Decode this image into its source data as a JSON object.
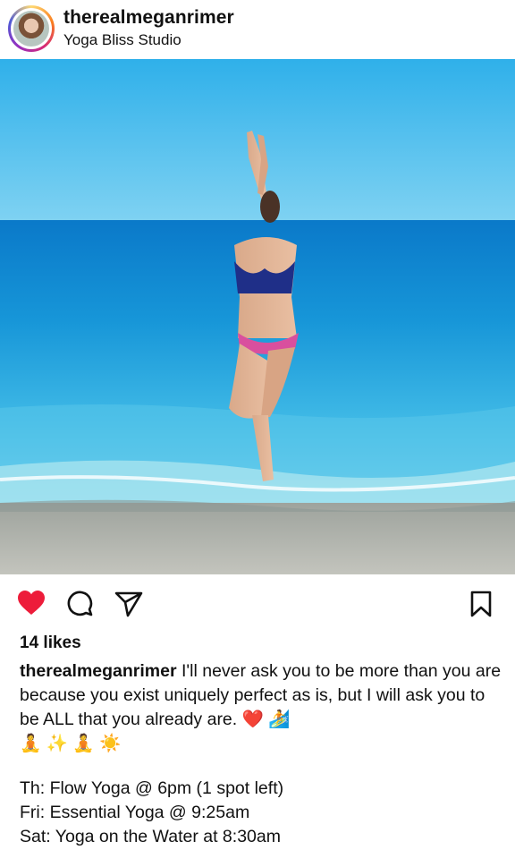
{
  "post": {
    "username": "therealmeganrimer",
    "location": "Yoga Bliss Studio",
    "likes": "14 likes",
    "caption_text": "I'll never ask you to be more than you are because you exist uniquely perfect as is, but I will ask you to be ALL that you already are. ❤️ 🏄",
    "caption_emoji_line": "🧘 ✨ 🧘 ☀️",
    "schedule": [
      "Th: Flow Yoga @ 6pm (1 spot left)",
      "Fri: Essential Yoga @ 9:25am",
      "Sat: Yoga on the Water at 8:30am"
    ]
  },
  "actions": {
    "like_icon": "heart-icon",
    "comment_icon": "comment-icon",
    "share_icon": "paper-plane-icon",
    "save_icon": "bookmark-icon",
    "like_color": "#ed1c3a"
  }
}
